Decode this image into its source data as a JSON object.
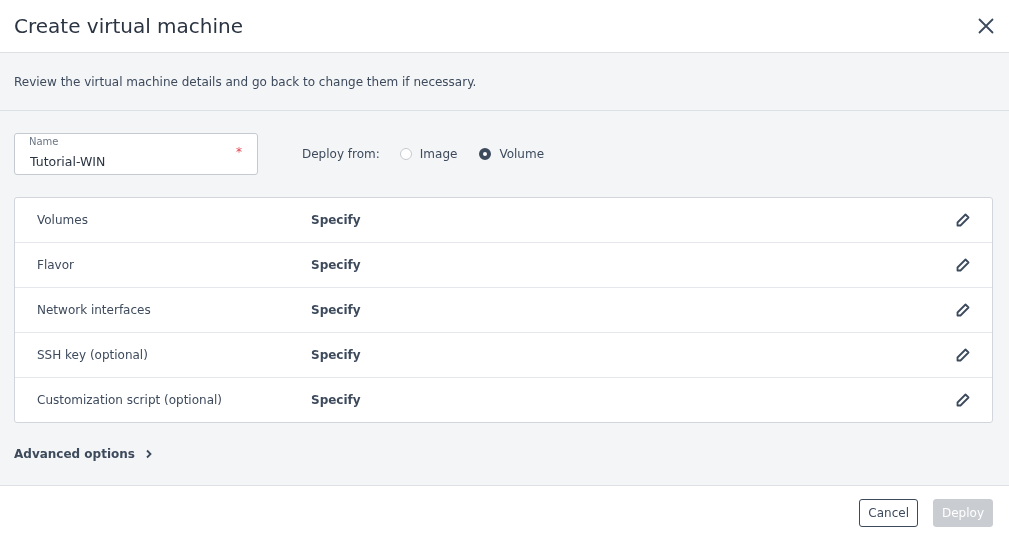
{
  "dialog": {
    "title": "Create virtual machine"
  },
  "description": "Review the virtual machine details and go back to change them if necessary.",
  "name_field": {
    "label": "Name",
    "value": "Tutorial-WIN",
    "required": true,
    "required_mark": "*"
  },
  "deploy_from": {
    "label": "Deploy from:",
    "options": [
      {
        "label": "Image",
        "selected": false
      },
      {
        "label": "Volume",
        "selected": true
      }
    ]
  },
  "settings": [
    {
      "name": "Volumes",
      "value": "Specify"
    },
    {
      "name": "Flavor",
      "value": "Specify"
    },
    {
      "name": "Network interfaces",
      "value": "Specify"
    },
    {
      "name": "SSH key (optional)",
      "value": "Specify"
    },
    {
      "name": "Customization script (optional)",
      "value": "Specify"
    }
  ],
  "advanced_options": {
    "label": "Advanced options",
    "expanded": false
  },
  "buttons": [
    {
      "label": "Cancel",
      "disabled": false
    },
    {
      "label": "Deploy",
      "disabled": true
    }
  ]
}
